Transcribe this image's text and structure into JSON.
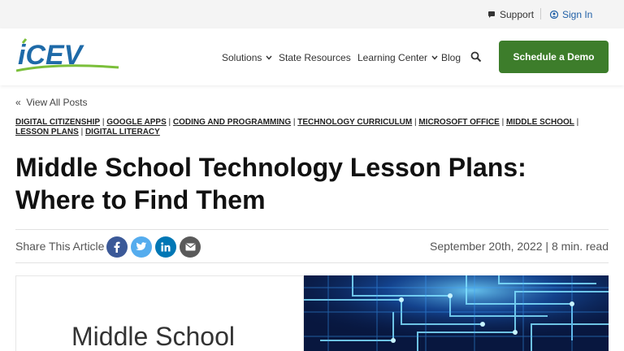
{
  "topbar": {
    "support_label": "Support",
    "signin_label": "Sign In"
  },
  "nav": {
    "logo_text": "iCEV",
    "items": [
      {
        "label": "Solutions",
        "dropdown": true
      },
      {
        "label": "State Resources",
        "dropdown": false
      },
      {
        "label": "Learning Center",
        "dropdown": true
      },
      {
        "label": "Blog",
        "dropdown": false
      }
    ],
    "cta_label": "Schedule a Demo"
  },
  "article": {
    "back_label": "View All Posts",
    "back_glyph": "«",
    "tags": [
      "DIGITAL CITIZENSHIP",
      "GOOGLE APPS",
      "CODING AND PROGRAMMING",
      "TECHNOLOGY CURRICULUM",
      "MICROSOFT OFFICE",
      "MIDDLE SCHOOL",
      "LESSON PLANS",
      "DIGITAL LITERACY"
    ],
    "title": "Middle School Technology Lesson Plans: Where to Find Them",
    "share_label": "Share This Article",
    "date_meta": "September 20th, 2022 | 8 min. read",
    "hero_text": "Middle School"
  },
  "colors": {
    "accent_green": "#3d7d2b",
    "link_blue": "#1f5fa6",
    "facebook": "#3b5998",
    "twitter": "#55acee",
    "linkedin": "#0077b5",
    "email": "#5a5a5a"
  },
  "share_icons": [
    "facebook-icon",
    "twitter-icon",
    "linkedin-icon",
    "email-icon"
  ]
}
